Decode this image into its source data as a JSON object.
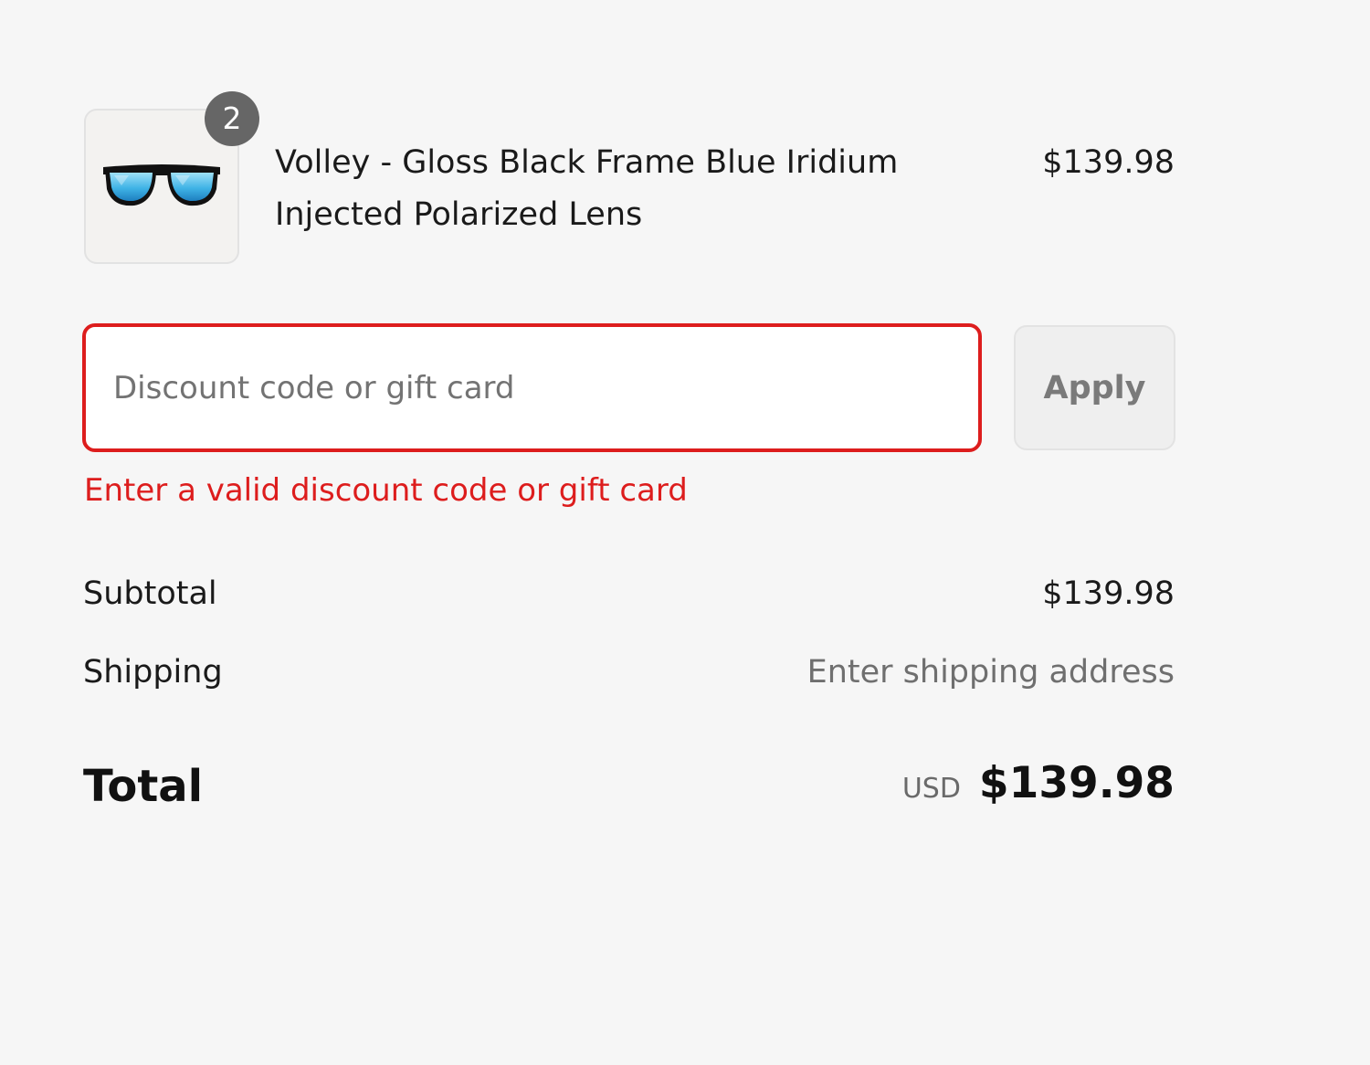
{
  "line_item": {
    "quantity": "2",
    "title": "Volley - Gloss Black Frame Blue Iridium Injected Polarized Lens",
    "price": "$139.98",
    "image_icon": "sunglasses-icon"
  },
  "discount": {
    "placeholder": "Discount code or gift card",
    "value": "",
    "apply_label": "Apply",
    "error": "Enter a valid discount code or gift card",
    "error_color": "#dd1d1d"
  },
  "summary": {
    "subtotal_label": "Subtotal",
    "subtotal_value": "$139.98",
    "shipping_label": "Shipping",
    "shipping_value": "Enter shipping address",
    "total_label": "Total",
    "total_currency": "USD",
    "total_value": "$139.98"
  }
}
